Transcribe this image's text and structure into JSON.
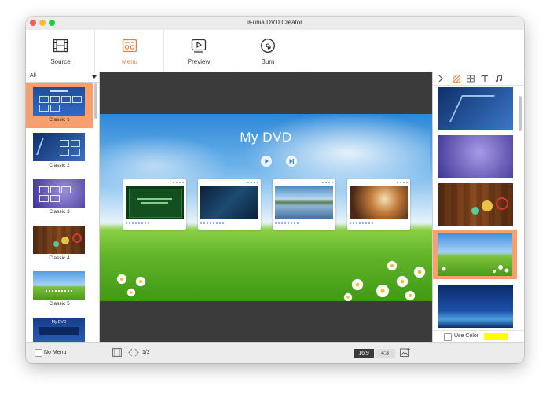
{
  "window": {
    "title": "iFunia DVD Creator"
  },
  "toolbar": {
    "items": [
      {
        "label": "Source",
        "icon": "film-icon",
        "active": false
      },
      {
        "label": "Menu",
        "icon": "menu-template-icon",
        "active": true
      },
      {
        "label": "Preview",
        "icon": "play-preview-icon",
        "active": false
      },
      {
        "label": "Burn",
        "icon": "disc-burn-icon",
        "active": false
      }
    ]
  },
  "left_panel": {
    "filter": "All",
    "themes": [
      {
        "label": "Classic 1",
        "selected": true
      },
      {
        "label": "Classic 2",
        "selected": false
      },
      {
        "label": "Classic 3",
        "selected": false
      },
      {
        "label": "Classic 4",
        "selected": false
      },
      {
        "label": "Classic 5",
        "selected": false
      },
      {
        "label": "My DVD",
        "selected": false
      }
    ]
  },
  "preview": {
    "dvd_title": "My DVD"
  },
  "right_panel": {
    "use_color_label": "Use Color",
    "use_color_checked": false,
    "color": "#ffff00"
  },
  "statusbar": {
    "no_menu_label": "No Menu",
    "page": "1/2",
    "ratio_16_9": "16:9",
    "ratio_4_3": "4:3"
  },
  "colors": {
    "accent": "#ef7c3f",
    "selection": "#f6a070"
  }
}
